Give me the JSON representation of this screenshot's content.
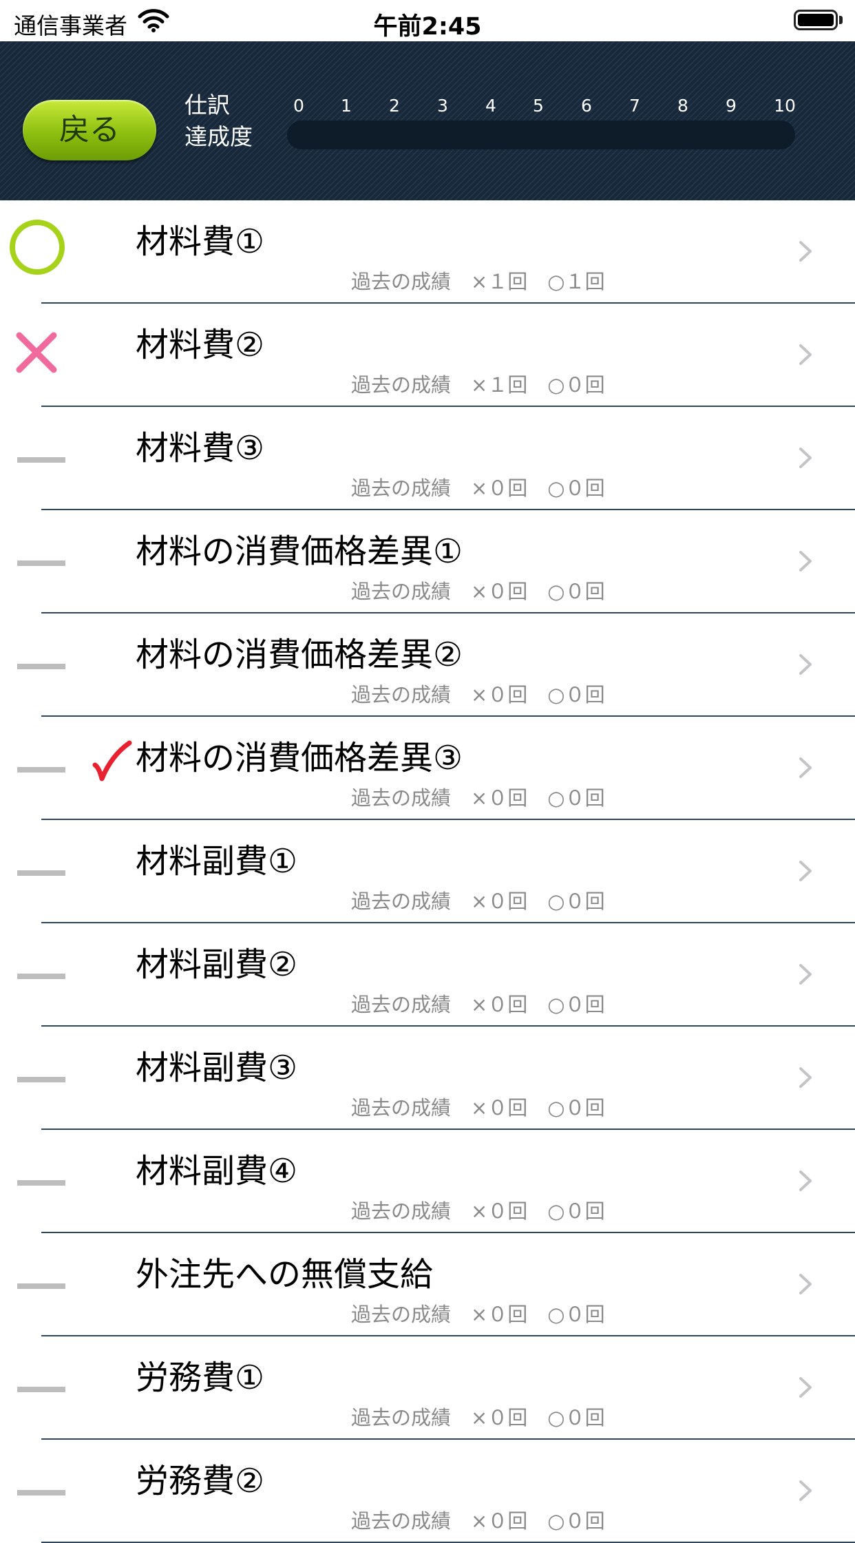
{
  "status_bar": {
    "carrier": "通信事業者",
    "time": "午前2:45"
  },
  "header": {
    "back_label": "戻る",
    "progress_title_line1": "仕訳",
    "progress_title_line2": "達成度",
    "scale": [
      "0",
      "1",
      "2",
      "3",
      "4",
      "5",
      "6",
      "7",
      "8",
      "9",
      "10"
    ],
    "progress_value": 0
  },
  "colors": {
    "header_bg": "#16283a",
    "accent_green": "#8dbf10",
    "wrong_pink": "#f06a9c",
    "check_red": "#e8202f",
    "separator": "#2c4565"
  },
  "items": [
    {
      "title": "材料費①",
      "history": "過去の成績　×１回　○１回",
      "mark": "correct",
      "checked": false
    },
    {
      "title": "材料費②",
      "history": "過去の成績　×１回　○０回",
      "mark": "wrong",
      "checked": false
    },
    {
      "title": "材料費③",
      "history": "過去の成績　×０回　○０回",
      "mark": "none",
      "checked": false
    },
    {
      "title": "材料の消費価格差異①",
      "history": "過去の成績　×０回　○０回",
      "mark": "none",
      "checked": false
    },
    {
      "title": "材料の消費価格差異②",
      "history": "過去の成績　×０回　○０回",
      "mark": "none",
      "checked": false
    },
    {
      "title": "材料の消費価格差異③",
      "history": "過去の成績　×０回　○０回",
      "mark": "none",
      "checked": true
    },
    {
      "title": "材料副費①",
      "history": "過去の成績　×０回　○０回",
      "mark": "none",
      "checked": false
    },
    {
      "title": "材料副費②",
      "history": "過去の成績　×０回　○０回",
      "mark": "none",
      "checked": false
    },
    {
      "title": "材料副費③",
      "history": "過去の成績　×０回　○０回",
      "mark": "none",
      "checked": false
    },
    {
      "title": "材料副費④",
      "history": "過去の成績　×０回　○０回",
      "mark": "none",
      "checked": false
    },
    {
      "title": "外注先への無償支給",
      "history": "過去の成績　×０回　○０回",
      "mark": "none",
      "checked": false
    },
    {
      "title": "労務費①",
      "history": "過去の成績　×０回　○０回",
      "mark": "none",
      "checked": false
    },
    {
      "title": "労務費②",
      "history": "過去の成績　×０回　○０回",
      "mark": "none",
      "checked": false
    }
  ]
}
